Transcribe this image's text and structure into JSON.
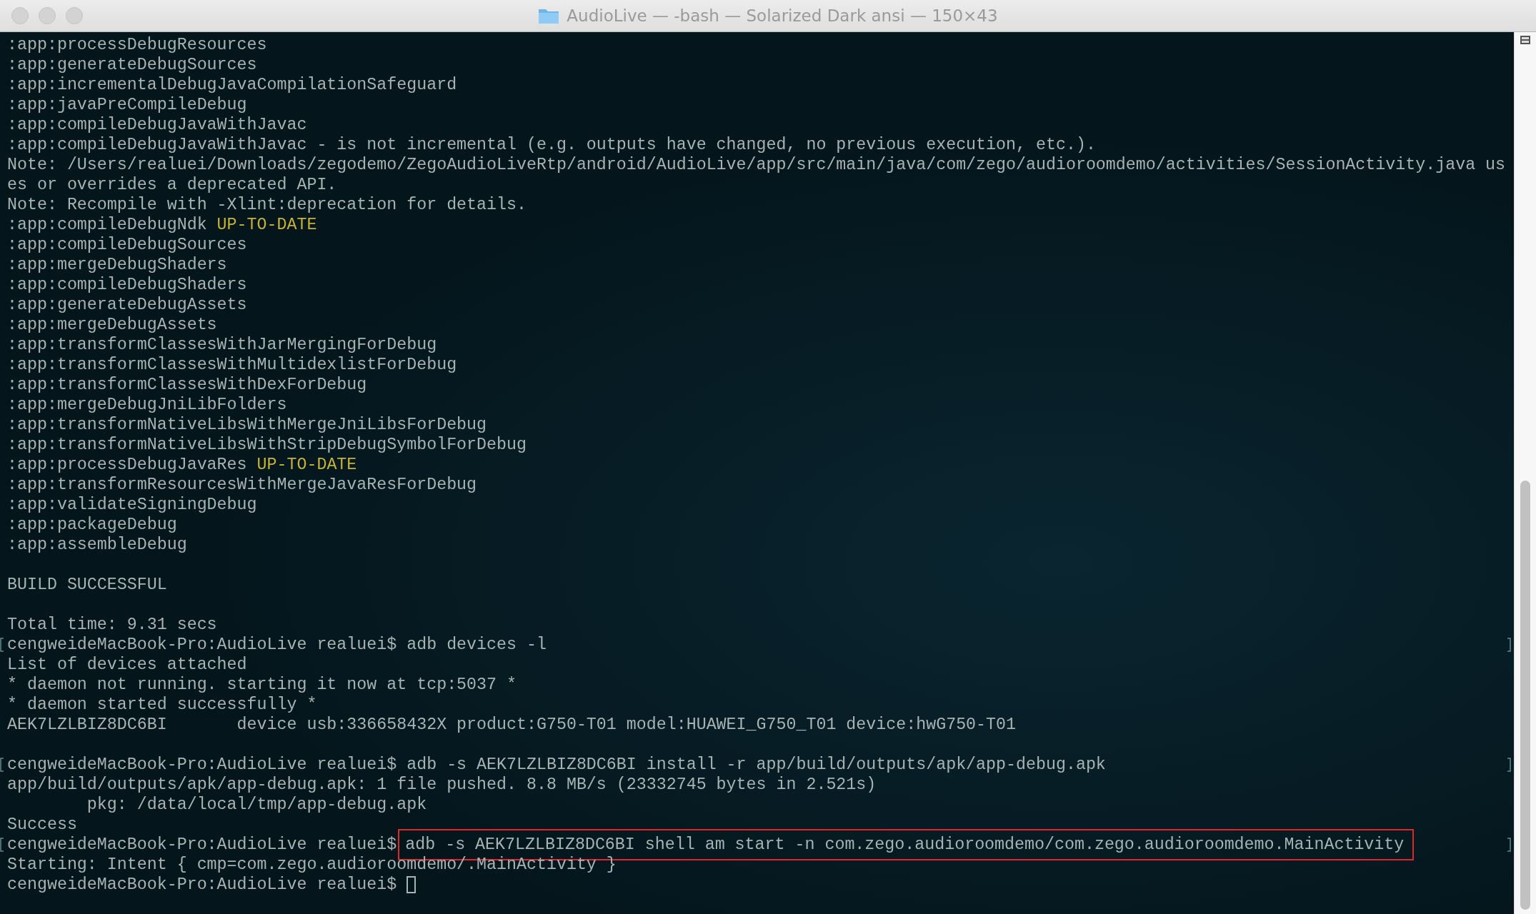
{
  "window": {
    "title": "AudioLive — -bash — Solarized Dark ansi — 150×43"
  },
  "lines": [
    {
      "marked": false,
      "segments": [
        {
          "kind": "plain",
          "text": ":app:processDebugResources"
        }
      ]
    },
    {
      "marked": false,
      "segments": [
        {
          "kind": "plain",
          "text": ":app:generateDebugSources"
        }
      ]
    },
    {
      "marked": false,
      "segments": [
        {
          "kind": "plain",
          "text": ":app:incrementalDebugJavaCompilationSafeguard"
        }
      ]
    },
    {
      "marked": false,
      "segments": [
        {
          "kind": "plain",
          "text": ":app:javaPreCompileDebug"
        }
      ]
    },
    {
      "marked": false,
      "segments": [
        {
          "kind": "plain",
          "text": ":app:compileDebugJavaWithJavac"
        }
      ]
    },
    {
      "marked": false,
      "segments": [
        {
          "kind": "plain",
          "text": ":app:compileDebugJavaWithJavac - is not incremental (e.g. outputs have changed, no previous execution, etc.)."
        }
      ]
    },
    {
      "marked": false,
      "segments": [
        {
          "kind": "plain",
          "text": "Note: /Users/realuei/Downloads/zegodemo/ZegoAudioLiveRtp/android/AudioLive/app/src/main/java/com/zego/audioroomdemo/activities/SessionActivity.java us"
        }
      ]
    },
    {
      "marked": false,
      "segments": [
        {
          "kind": "plain",
          "text": "es or overrides a deprecated API."
        }
      ]
    },
    {
      "marked": false,
      "segments": [
        {
          "kind": "plain",
          "text": "Note: Recompile with -Xlint:deprecation for details."
        }
      ]
    },
    {
      "marked": false,
      "segments": [
        {
          "kind": "plain",
          "text": ":app:compileDebugNdk"
        },
        {
          "kind": "status",
          "text": "UP-TO-DATE"
        }
      ]
    },
    {
      "marked": false,
      "segments": [
        {
          "kind": "plain",
          "text": ":app:compileDebugSources"
        }
      ]
    },
    {
      "marked": false,
      "segments": [
        {
          "kind": "plain",
          "text": ":app:mergeDebugShaders"
        }
      ]
    },
    {
      "marked": false,
      "segments": [
        {
          "kind": "plain",
          "text": ":app:compileDebugShaders"
        }
      ]
    },
    {
      "marked": false,
      "segments": [
        {
          "kind": "plain",
          "text": ":app:generateDebugAssets"
        }
      ]
    },
    {
      "marked": false,
      "segments": [
        {
          "kind": "plain",
          "text": ":app:mergeDebugAssets"
        }
      ]
    },
    {
      "marked": false,
      "segments": [
        {
          "kind": "plain",
          "text": ":app:transformClassesWithJarMergingForDebug"
        }
      ]
    },
    {
      "marked": false,
      "segments": [
        {
          "kind": "plain",
          "text": ":app:transformClassesWithMultidexlistForDebug"
        }
      ]
    },
    {
      "marked": false,
      "segments": [
        {
          "kind": "plain",
          "text": ":app:transformClassesWithDexForDebug"
        }
      ]
    },
    {
      "marked": false,
      "segments": [
        {
          "kind": "plain",
          "text": ":app:mergeDebugJniLibFolders"
        }
      ]
    },
    {
      "marked": false,
      "segments": [
        {
          "kind": "plain",
          "text": ":app:transformNativeLibsWithMergeJniLibsForDebug"
        }
      ]
    },
    {
      "marked": false,
      "segments": [
        {
          "kind": "plain",
          "text": ":app:transformNativeLibsWithStripDebugSymbolForDebug"
        }
      ]
    },
    {
      "marked": false,
      "segments": [
        {
          "kind": "plain",
          "text": ":app:processDebugJavaRes"
        },
        {
          "kind": "status",
          "text": "UP-TO-DATE"
        }
      ]
    },
    {
      "marked": false,
      "segments": [
        {
          "kind": "plain",
          "text": ":app:transformResourcesWithMergeJavaResForDebug"
        }
      ]
    },
    {
      "marked": false,
      "segments": [
        {
          "kind": "plain",
          "text": ":app:validateSigningDebug"
        }
      ]
    },
    {
      "marked": false,
      "segments": [
        {
          "kind": "plain",
          "text": ":app:packageDebug"
        }
      ]
    },
    {
      "marked": false,
      "segments": [
        {
          "kind": "plain",
          "text": ":app:assembleDebug"
        }
      ]
    },
    {
      "marked": false
    },
    {
      "marked": false,
      "segments": [
        {
          "kind": "plain",
          "text": "BUILD SUCCESSFUL"
        }
      ]
    },
    {
      "marked": false
    },
    {
      "marked": false,
      "segments": [
        {
          "kind": "plain",
          "text": "Total time: 9.31 secs"
        }
      ]
    },
    {
      "marked": true,
      "segments": [
        {
          "kind": "plain",
          "text": "cengweideMacBook-Pro:AudioLive realuei$ adb devices -l"
        }
      ]
    },
    {
      "marked": false,
      "segments": [
        {
          "kind": "plain",
          "text": "List of devices attached"
        }
      ]
    },
    {
      "marked": false,
      "segments": [
        {
          "kind": "plain",
          "text": "* daemon not running. starting it now at tcp:5037 *"
        }
      ]
    },
    {
      "marked": false,
      "segments": [
        {
          "kind": "plain",
          "text": "* daemon started successfully *"
        }
      ]
    },
    {
      "marked": false,
      "segments": [
        {
          "kind": "plain",
          "text": "AEK7LZLBIZ8DC6BI       device usb:336658432X product:G750-T01 model:HUAWEI_G750_T01 device:hwG750-T01"
        }
      ]
    },
    {
      "marked": false
    },
    {
      "marked": true,
      "segments": [
        {
          "kind": "plain",
          "text": "cengweideMacBook-Pro:AudioLive realuei$ adb -s AEK7LZLBIZ8DC6BI install -r app/build/outputs/apk/app-debug.apk"
        }
      ]
    },
    {
      "marked": false,
      "segments": [
        {
          "kind": "plain",
          "text": "app/build/outputs/apk/app-debug.apk: 1 file pushed. 8.8 MB/s (23332745 bytes in 2.521s)"
        }
      ]
    },
    {
      "marked": false,
      "segments": [
        {
          "kind": "plain",
          "text": "        pkg: /data/local/tmp/app-debug.apk"
        }
      ]
    },
    {
      "marked": false,
      "segments": [
        {
          "kind": "plain",
          "text": "Success"
        }
      ]
    },
    {
      "marked": true,
      "segments": [
        {
          "kind": "plain",
          "text": "cengweideMacBook-Pro:AudioLive realuei$"
        },
        {
          "kind": "boxed",
          "text": "adb -s AEK7LZLBIZ8DC6BI shell am start -n com.zego.audioroomdemo/com.zego.audioroomdemo.MainActivity"
        }
      ]
    },
    {
      "marked": false,
      "segments": [
        {
          "kind": "plain",
          "text": "Starting: Intent { cmp=com.zego.audioroomdemo/.MainActivity }"
        }
      ]
    },
    {
      "marked": false,
      "cursor": true,
      "segments": [
        {
          "kind": "plain",
          "text": "cengweideMacBook-Pro:AudioLive realuei$"
        }
      ]
    }
  ]
}
